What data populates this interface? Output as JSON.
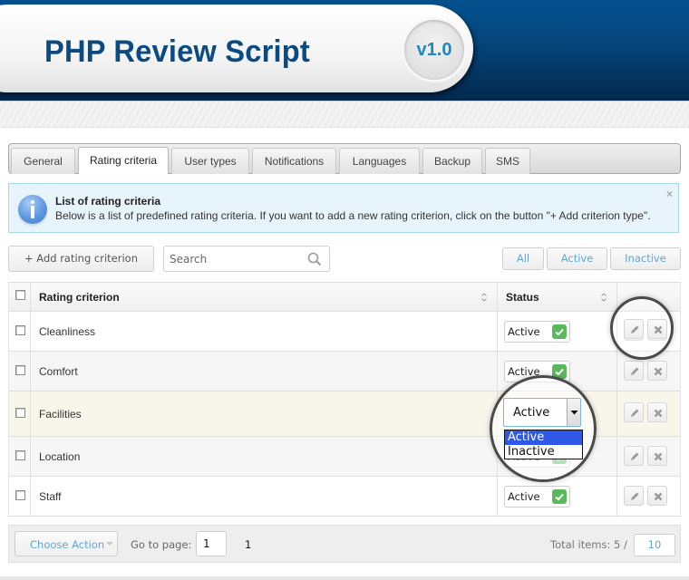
{
  "header": {
    "title": "PHP Review Script",
    "version": "v1.0"
  },
  "tabs": [
    {
      "label": "General",
      "active": false
    },
    {
      "label": "Rating criteria",
      "active": true
    },
    {
      "label": "User types",
      "active": false
    },
    {
      "label": "Notifications",
      "active": false
    },
    {
      "label": "Languages",
      "active": false
    },
    {
      "label": "Backup",
      "active": false
    },
    {
      "label": "SMS",
      "active": false
    }
  ],
  "info": {
    "icon": "info-icon",
    "title": "List of rating criteria",
    "text": "Below is a list of predefined rating criteria. If you want to add a new rating criterion, click on the button \"+ Add criterion type\".",
    "close": "×"
  },
  "toolbar": {
    "add_label": "+ Add rating criterion",
    "search_placeholder": "Search",
    "filters": [
      "All",
      "Active",
      "Inactive"
    ]
  },
  "table": {
    "columns": [
      "Rating criterion",
      "Status"
    ],
    "rows": [
      {
        "name": "Cleanliness",
        "status": "Active"
      },
      {
        "name": "Comfort",
        "status": "Active"
      },
      {
        "name": "Facilities",
        "status": "Active"
      },
      {
        "name": "Location",
        "status": "Active"
      },
      {
        "name": "Staff",
        "status": "Active"
      }
    ]
  },
  "dropdown": {
    "value": "Active",
    "options": [
      "Active",
      "Inactive"
    ],
    "highlighted": "Active"
  },
  "footer": {
    "choose_action": "Choose Action",
    "goto_label": "Go to page:",
    "goto_value": "1",
    "page_link": "1",
    "total_label": "Total items: 5 /",
    "per_page": "10"
  },
  "colors": {
    "header_blue": "#05528f",
    "title_blue": "#0c4a82",
    "status_green": "#5cb85c",
    "link_blue": "#5fa6d6",
    "dropdown_highlight": "#3058e6"
  }
}
